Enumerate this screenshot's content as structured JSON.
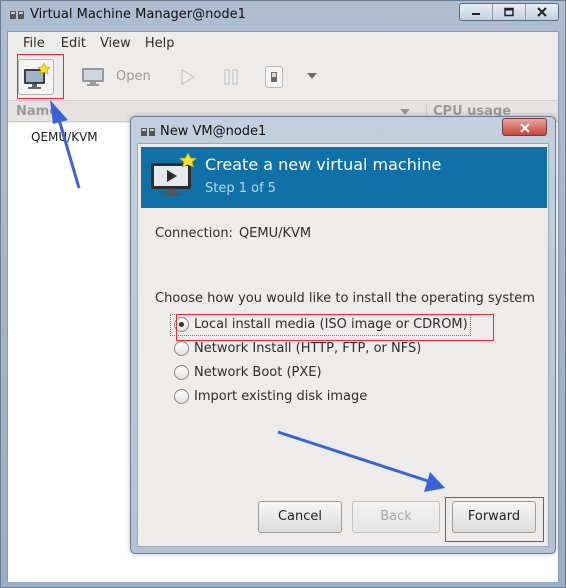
{
  "window": {
    "title": "Virtual Machine Manager@node1"
  },
  "menubar": {
    "items": [
      "File",
      "Edit",
      "View",
      "Help"
    ]
  },
  "toolbar": {
    "open_label": "Open"
  },
  "vm_list": {
    "columns": {
      "name": "Name",
      "cpu": "CPU usage"
    },
    "rows": [
      "QEMU/KVM"
    ]
  },
  "dialog": {
    "title": "New VM@node1",
    "banner_title": "Create a new virtual machine",
    "banner_step": "Step 1 of 5",
    "connection_label": "Connection:",
    "connection_value": "QEMU/KVM",
    "choose_label": "Choose how you would like to install the operating system",
    "options": [
      {
        "label": "Local install media (ISO image or CDROM)",
        "checked": true
      },
      {
        "label": "Network Install (HTTP, FTP, or NFS)",
        "checked": false
      },
      {
        "label": "Network Boot (PXE)",
        "checked": false
      },
      {
        "label": "Import existing disk image",
        "checked": false
      }
    ],
    "buttons": {
      "cancel": "Cancel",
      "back": "Back",
      "forward": "Forward"
    }
  },
  "colors": {
    "banner": "#0f71a8",
    "annotation_box": "#e03030",
    "annotation_arrow": "#3b63d6"
  }
}
